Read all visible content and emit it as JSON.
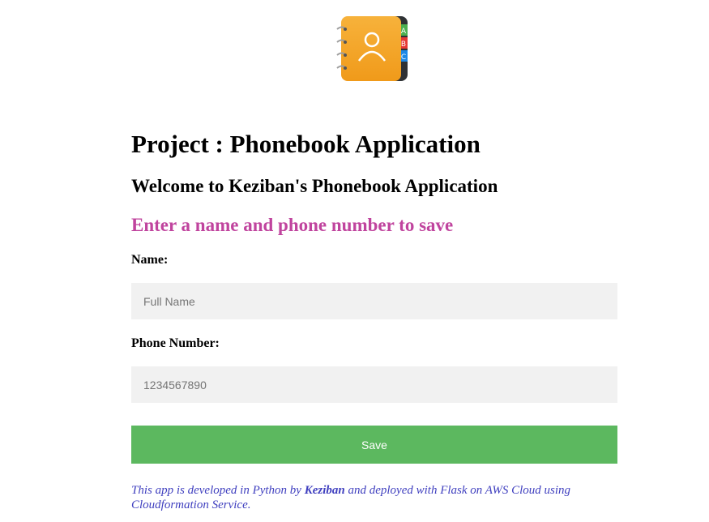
{
  "logo": {
    "icon": "address-book-icon",
    "tab_letters": [
      "A",
      "B",
      "C"
    ],
    "colors": {
      "cover": "#f5a623",
      "spine": "#2f3235",
      "tab_a": "#4caf50",
      "tab_b": "#e53935",
      "tab_c": "#1e88e5"
    }
  },
  "header": {
    "title": "Project : Phonebook Application",
    "welcome": "Welcome to Keziban's Phonebook Application",
    "prompt": "Enter a name and phone number to save"
  },
  "form": {
    "name_label": "Name:",
    "name_placeholder": "Full Name",
    "name_value": "",
    "phone_label": "Phone Number:",
    "phone_placeholder": "1234567890",
    "phone_value": "",
    "save_label": "Save"
  },
  "footer": {
    "text_before": "This app is developed in Python by ",
    "author": "Keziban",
    "text_after": " and deployed with Flask on AWS Cloud using Cloudformation Service."
  },
  "colors": {
    "prompt": "#c0449e",
    "save_button": "#5cb85f",
    "input_background": "#f1f1f1",
    "footer_text": "#3f3fbf"
  }
}
